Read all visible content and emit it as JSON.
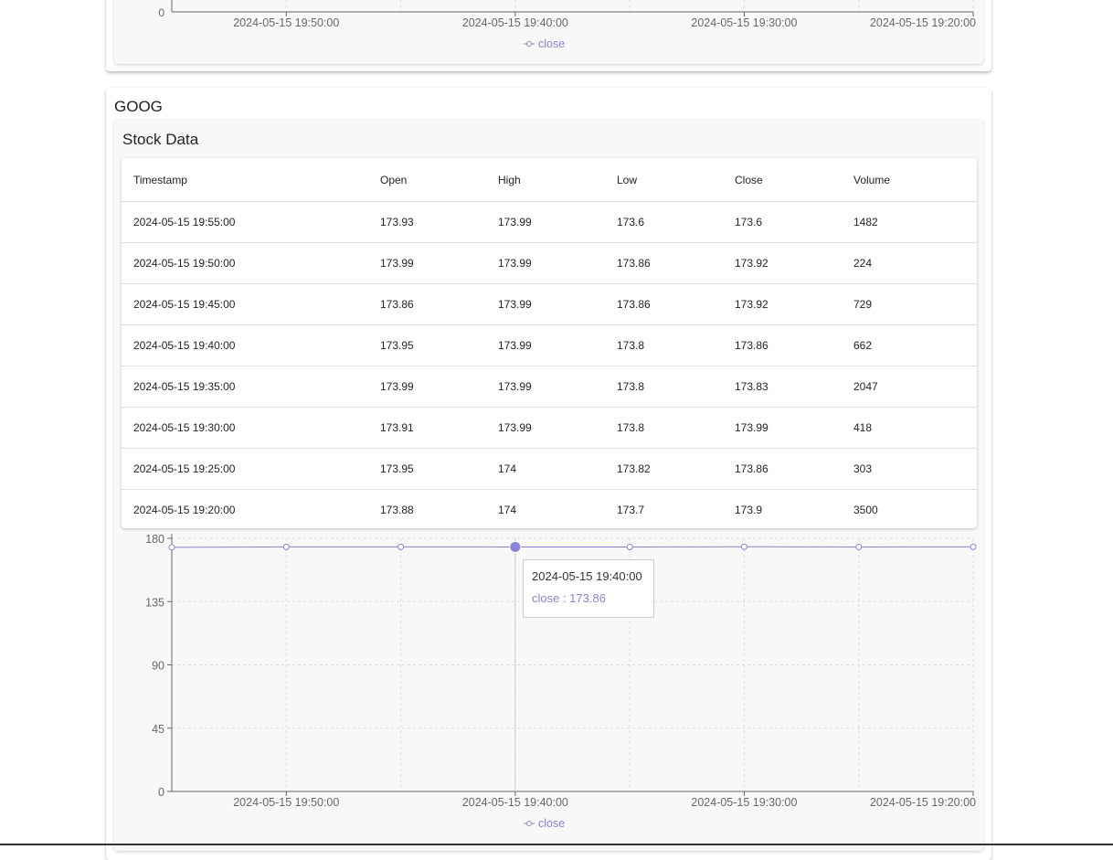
{
  "top_chart": {
    "x_ticks": [
      "2024-05-15 19:50:00",
      "2024-05-15 19:40:00",
      "2024-05-15 19:30:00",
      "2024-05-15 19:20:00"
    ],
    "y_tick_zero": "0",
    "legend": "close"
  },
  "goog": {
    "ticker": "GOOG",
    "section_title": "Stock Data",
    "table": {
      "headers": [
        "Timestamp",
        "Open",
        "High",
        "Low",
        "Close",
        "Volume"
      ],
      "rows": [
        [
          "2024-05-15 19:55:00",
          "173.93",
          "173.99",
          "173.6",
          "173.6",
          "1482"
        ],
        [
          "2024-05-15 19:50:00",
          "173.99",
          "173.99",
          "173.86",
          "173.92",
          "224"
        ],
        [
          "2024-05-15 19:45:00",
          "173.86",
          "173.99",
          "173.86",
          "173.92",
          "729"
        ],
        [
          "2024-05-15 19:40:00",
          "173.95",
          "173.99",
          "173.8",
          "173.86",
          "662"
        ],
        [
          "2024-05-15 19:35:00",
          "173.99",
          "173.99",
          "173.8",
          "173.83",
          "2047"
        ],
        [
          "2024-05-15 19:30:00",
          "173.91",
          "173.99",
          "173.8",
          "173.99",
          "418"
        ],
        [
          "2024-05-15 19:25:00",
          "173.95",
          "174",
          "173.82",
          "173.86",
          "303"
        ],
        [
          "2024-05-15 19:20:00",
          "173.88",
          "174",
          "173.7",
          "173.9",
          "3500"
        ]
      ]
    },
    "tooltip": {
      "label": "2024-05-15 19:40:00",
      "value_text": "close : 173.86"
    }
  },
  "chart_data": {
    "type": "line",
    "x": [
      "2024-05-15 19:55:00",
      "2024-05-15 19:50:00",
      "2024-05-15 19:45:00",
      "2024-05-15 19:40:00",
      "2024-05-15 19:35:00",
      "2024-05-15 19:30:00",
      "2024-05-15 19:25:00",
      "2024-05-15 19:20:00"
    ],
    "x_tick_labels": [
      "2024-05-15 19:50:00",
      "2024-05-15 19:40:00",
      "2024-05-15 19:30:00",
      "2024-05-15 19:20:00"
    ],
    "series": [
      {
        "name": "close",
        "values": [
          173.6,
          173.92,
          173.92,
          173.86,
          173.83,
          173.99,
          173.86,
          173.9
        ]
      }
    ],
    "ylim": [
      0,
      180
    ],
    "y_ticks": [
      "0",
      "45",
      "90",
      "135",
      "180"
    ],
    "active_index": 3,
    "grid": true,
    "legend": "bottom",
    "color": "#8884d8"
  }
}
